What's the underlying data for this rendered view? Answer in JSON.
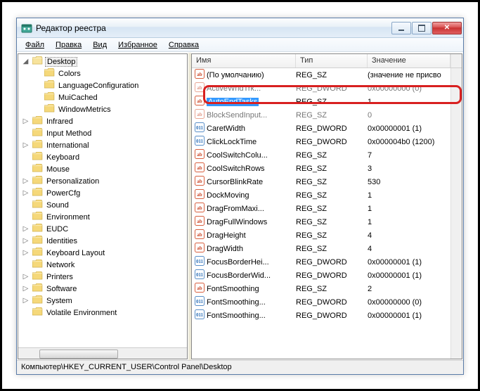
{
  "window": {
    "title": "Редактор реестра"
  },
  "menu": {
    "file": "Файл",
    "edit": "Правка",
    "view": "Вид",
    "favorites": "Избранное",
    "help": "Справка"
  },
  "tree": {
    "items": [
      {
        "level": 1,
        "toggle": "open",
        "label": "Desktop",
        "selected": true
      },
      {
        "level": 2,
        "toggle": "none",
        "label": "Colors"
      },
      {
        "level": 2,
        "toggle": "none",
        "label": "LanguageConfiguration"
      },
      {
        "level": 2,
        "toggle": "none",
        "label": "MuiCached"
      },
      {
        "level": 2,
        "toggle": "none",
        "label": "WindowMetrics"
      },
      {
        "level": 1,
        "toggle": "closed",
        "label": "Infrared"
      },
      {
        "level": 1,
        "toggle": "none",
        "label": "Input Method"
      },
      {
        "level": 1,
        "toggle": "closed",
        "label": "International"
      },
      {
        "level": 1,
        "toggle": "none",
        "label": "Keyboard"
      },
      {
        "level": 1,
        "toggle": "none",
        "label": "Mouse"
      },
      {
        "level": 1,
        "toggle": "closed",
        "label": "Personalization"
      },
      {
        "level": 1,
        "toggle": "closed",
        "label": "PowerCfg"
      },
      {
        "level": 1,
        "toggle": "none",
        "label": "Sound"
      },
      {
        "level": 1,
        "toggle": "none",
        "label": "Environment",
        "folderType": "folder2"
      },
      {
        "level": 1,
        "toggle": "closed",
        "label": "EUDC",
        "folderType": "folder2"
      },
      {
        "level": 1,
        "toggle": "closed",
        "label": "Identities",
        "folderType": "folder2"
      },
      {
        "level": 1,
        "toggle": "closed",
        "label": "Keyboard Layout",
        "folderType": "folder2"
      },
      {
        "level": 1,
        "toggle": "none",
        "label": "Network",
        "folderType": "folder2"
      },
      {
        "level": 1,
        "toggle": "closed",
        "label": "Printers",
        "folderType": "folder2"
      },
      {
        "level": 1,
        "toggle": "closed",
        "label": "Software",
        "folderType": "folder2"
      },
      {
        "level": 1,
        "toggle": "closed",
        "label": "System",
        "folderType": "folder2"
      },
      {
        "level": 1,
        "toggle": "none",
        "label": "Volatile Environment",
        "folderType": "folder2"
      }
    ]
  },
  "list": {
    "headers": {
      "name": "Имя",
      "type": "Тип",
      "value": "Значение"
    },
    "rows": [
      {
        "icon": "sz",
        "name": "(По умолчанию)",
        "type": "REG_SZ",
        "value": "(значение не присво",
        "cut": false
      },
      {
        "icon": "sz",
        "name": "ActiveWndTrk...",
        "type": "REG_DWORD",
        "value": "0x00000000 (0)",
        "cut": true
      },
      {
        "icon": "sz",
        "name": "AutoEndTasks",
        "type": "REG_SZ",
        "value": "1",
        "selected": true
      },
      {
        "icon": "sz",
        "name": "BlockSendInput...",
        "type": "REG_SZ",
        "value": "0",
        "cut": true
      },
      {
        "icon": "dw",
        "name": "CaretWidth",
        "type": "REG_DWORD",
        "value": "0x00000001 (1)"
      },
      {
        "icon": "dw",
        "name": "ClickLockTime",
        "type": "REG_DWORD",
        "value": "0x000004b0 (1200)"
      },
      {
        "icon": "sz",
        "name": "CoolSwitchColu...",
        "type": "REG_SZ",
        "value": "7"
      },
      {
        "icon": "sz",
        "name": "CoolSwitchRows",
        "type": "REG_SZ",
        "value": "3"
      },
      {
        "icon": "sz",
        "name": "CursorBlinkRate",
        "type": "REG_SZ",
        "value": "530"
      },
      {
        "icon": "sz",
        "name": "DockMoving",
        "type": "REG_SZ",
        "value": "1"
      },
      {
        "icon": "sz",
        "name": "DragFromMaxi...",
        "type": "REG_SZ",
        "value": "1"
      },
      {
        "icon": "sz",
        "name": "DragFullWindows",
        "type": "REG_SZ",
        "value": "1"
      },
      {
        "icon": "sz",
        "name": "DragHeight",
        "type": "REG_SZ",
        "value": "4"
      },
      {
        "icon": "sz",
        "name": "DragWidth",
        "type": "REG_SZ",
        "value": "4"
      },
      {
        "icon": "dw",
        "name": "FocusBorderHei...",
        "type": "REG_DWORD",
        "value": "0x00000001 (1)"
      },
      {
        "icon": "dw",
        "name": "FocusBorderWid...",
        "type": "REG_DWORD",
        "value": "0x00000001 (1)"
      },
      {
        "icon": "sz",
        "name": "FontSmoothing",
        "type": "REG_SZ",
        "value": "2"
      },
      {
        "icon": "dw",
        "name": "FontSmoothing...",
        "type": "REG_DWORD",
        "value": "0x00000000 (0)"
      },
      {
        "icon": "dw",
        "name": "FontSmoothing...",
        "type": "REG_DWORD",
        "value": "0x00000001 (1)"
      }
    ]
  },
  "statusbar": {
    "path": "Компьютер\\HKEY_CURRENT_USER\\Control Panel\\Desktop"
  }
}
